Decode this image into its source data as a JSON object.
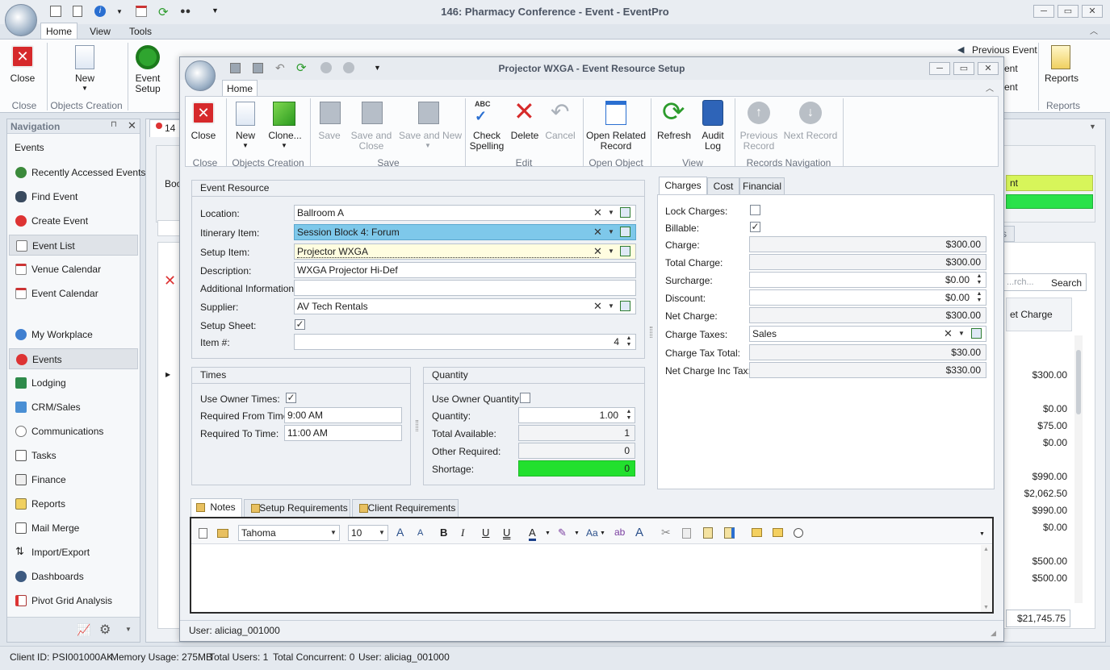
{
  "main_window": {
    "title": "146: Pharmacy Conference - Event - EventPro",
    "tabs": [
      "Home",
      "View",
      "Tools"
    ],
    "ribbon": {
      "close": "Close",
      "new": "New",
      "event_setup": "Event Setup",
      "groups": {
        "close": "Close",
        "objects_creation": "Objects Creation",
        "reports": "Reports"
      },
      "previous_event": "Previous Event",
      "reports": "Reports",
      "partial_right_1": "ent",
      "partial_right_2": "ent"
    }
  },
  "navigation": {
    "title": "Navigation",
    "events_header": "Events",
    "sub_items": [
      "Recently Accessed Events",
      "Find Event",
      "Create Event",
      "Event List",
      "Venue Calendar",
      "Event Calendar"
    ],
    "modules": [
      "My Workplace",
      "Events",
      "Lodging",
      "CRM/Sales",
      "Communications",
      "Tasks",
      "Finance",
      "Reports",
      "Mail Merge",
      "Import/Export",
      "Dashboards",
      "Pivot Grid Analysis"
    ]
  },
  "background": {
    "tab_partial": "14",
    "book_partial": "Book",
    "right_panel_partial": "nt",
    "right_tab_partial": "s",
    "search_placeholder": "...rch...",
    "search_button": "Search",
    "column_header": "et Charge",
    "values": [
      "$300.00",
      "$0.00",
      "$75.00",
      "$0.00",
      "$990.00",
      "$2,062.50",
      "$990.00",
      "$0.00",
      "$500.00",
      "$500.00"
    ],
    "total": "$21,745.75"
  },
  "dialog": {
    "title": "Projector WXGA - Event Resource Setup",
    "tab": "Home",
    "ribbon": {
      "close": "Close",
      "new": "New",
      "clone": "Clone...",
      "save": "Save",
      "save_and_close_1": "Save and",
      "save_and_close_2": "Close",
      "save_and_new": "Save and New",
      "check_spelling_1": "Check",
      "check_spelling_2": "Spelling",
      "delete": "Delete",
      "cancel": "Cancel",
      "open_related_1": "Open Related",
      "open_related_2": "Record",
      "refresh": "Refresh",
      "audit_log_1": "Audit",
      "audit_log_2": "Log",
      "previous_record_1": "Previous",
      "previous_record_2": "Record",
      "next_record": "Next Record",
      "groups": {
        "close": "Close",
        "objects_creation": "Objects Creation",
        "save": "Save",
        "edit": "Edit",
        "open_object": "Open Object",
        "view": "View",
        "records_navigation": "Records Navigation"
      }
    },
    "event_resource": {
      "title": "Event Resource",
      "location_label": "Location:",
      "location": "Ballroom A",
      "itinerary_label": "Itinerary Item:",
      "itinerary": "Session Block 4: Forum",
      "setup_item_label": "Setup Item:",
      "setup_item": "Projector WXGA",
      "description_label": "Description:",
      "description": "WXGA Projector Hi-Def",
      "additional_info_label": "Additional Information:",
      "additional_info": "",
      "supplier_label": "Supplier:",
      "supplier": "AV Tech Rentals",
      "setup_sheet_label": "Setup Sheet:",
      "setup_sheet_checked": true,
      "item_num_label": "Item #:",
      "item_num": "4"
    },
    "times": {
      "title": "Times",
      "use_owner_times_label": "Use Owner Times:",
      "use_owner_times_checked": true,
      "required_from_label": "Required From Time:",
      "required_from": "9:00 AM",
      "required_to_label": "Required To Time:",
      "required_to": "11:00 AM"
    },
    "quantity": {
      "title": "Quantity",
      "use_owner_quantity_label": "Use Owner Quantity:",
      "use_owner_quantity_checked": false,
      "quantity_label": "Quantity:",
      "quantity": "1.00",
      "total_available_label": "Total Available:",
      "total_available": "1",
      "other_required_label": "Other Required:",
      "other_required": "0",
      "shortage_label": "Shortage:",
      "shortage": "0"
    },
    "charges": {
      "tabs": [
        "Charges",
        "Cost",
        "Financial"
      ],
      "lock_charges_label": "Lock Charges:",
      "lock_charges_checked": false,
      "billable_label": "Billable:",
      "billable_checked": true,
      "charge_label": "Charge:",
      "charge": "$300.00",
      "total_charge_label": "Total Charge:",
      "total_charge": "$300.00",
      "surcharge_label": "Surcharge:",
      "surcharge": "$0.00",
      "discount_label": "Discount:",
      "discount": "$0.00",
      "net_charge_label": "Net Charge:",
      "net_charge": "$300.00",
      "charge_taxes_label": "Charge Taxes:",
      "charge_taxes": "Sales",
      "charge_tax_total_label": "Charge Tax Total:",
      "charge_tax_total": "$30.00",
      "net_charge_inc_tax_label": "Net Charge Inc Tax:",
      "net_charge_inc_tax": "$330.00"
    },
    "notes": {
      "tabs": [
        "Notes",
        "Setup Requirements",
        "Client Requirements"
      ],
      "font": "Tahoma",
      "size": "10"
    },
    "status_user": "User: aliciag_001000"
  },
  "status_bar": {
    "client_id": "Client ID: PSI001000AK",
    "memory": "Memory Usage: 275MB",
    "total_users": "Total Users: 1",
    "total_concurrent": "Total Concurrent: 0",
    "user": "User: aliciag_001000"
  },
  "colors": {
    "accent_blue": "#7ec8ea",
    "setup_item_highlight": "#fffde0",
    "shortage_green": "#22e02e",
    "lime_panel": "#d7f55a",
    "green_panel": "#2ae24a",
    "close_red": "#d6292b"
  }
}
